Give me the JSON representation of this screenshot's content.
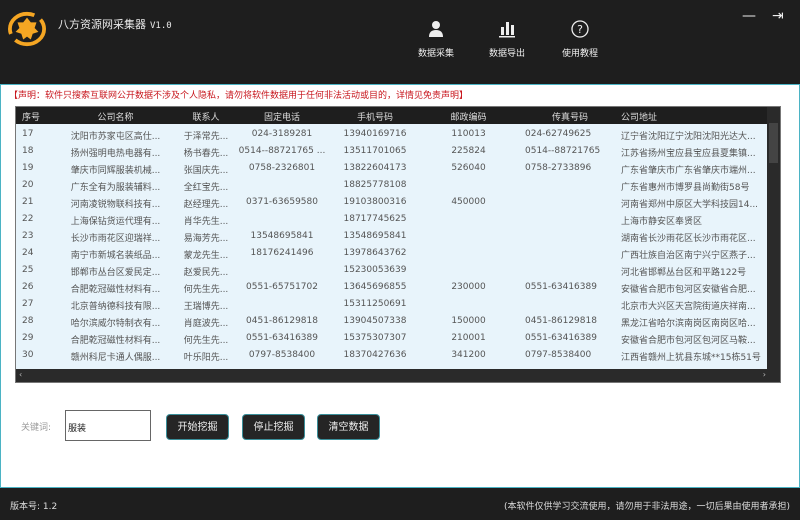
{
  "app": {
    "title": "八方资源网采集器",
    "version": "V1.0"
  },
  "nav": [
    {
      "label": "数据采集",
      "icon": "user-icon"
    },
    {
      "label": "数据导出",
      "icon": "bar-chart-icon"
    },
    {
      "label": "使用教程",
      "icon": "help-icon"
    }
  ],
  "window": {
    "minimize": "—",
    "exit": "⇥"
  },
  "notice": "【声明：软件只搜索互联网公开数据不涉及个人隐私，请勿将软件数据用于任何非法活动或目的，详情见免责声明】",
  "table": {
    "columns": [
      "序号",
      "公司名称",
      "联系人",
      "固定电话",
      "手机号码",
      "邮政编码",
      "传真号码",
      "公司地址"
    ],
    "rows": [
      [
        "17",
        "沈阳市苏家屯区高仕...",
        "于泽常先...",
        "024-3189281",
        "13940169716",
        "110013",
        "024-62749625",
        "辽宁省沈阳辽宁沈阳沈阳光达大..."
      ],
      [
        "18",
        "扬州强明电热电器有...",
        "杨书春先...",
        "0514--88721765 ...",
        "13511701065",
        "225824",
        "0514--88721765",
        "江苏省扬州宝应县宝应县夏集镇..."
      ],
      [
        "19",
        "肇庆市同辉服装机械...",
        "张国庆先...",
        "0758-2326801",
        "13822604173",
        "526040",
        "0758-2733896",
        "广东省肇庆市广东省肇庆市端州..."
      ],
      [
        "20",
        "广东全有为服装辅料...",
        "全红宝先...",
        "",
        "18825778108",
        "",
        "",
        "广东省惠州市博罗县尚勤街58号"
      ],
      [
        "21",
        "河南凌锐物联科技有...",
        "赵经理先...",
        "0371-63659580",
        "19103800316",
        "450000",
        "",
        "河南省郑州中原区大学科技园14..."
      ],
      [
        "22",
        "上海保钻货运代理有...",
        "肖华先生...",
        "",
        "18717745625",
        "",
        "",
        "上海市静安区奉贤区"
      ],
      [
        "23",
        "长沙市雨花区迎瑞祥...",
        "易海芳先...",
        "13548695841",
        "13548695841",
        "",
        "",
        "湖南省长沙雨花区长沙市雨花区..."
      ],
      [
        "24",
        "南宁市新城名装纸品...",
        "蒙龙先生...",
        "18176241496",
        "13978643762",
        "",
        "",
        "广西壮族自治区南宁兴宁区燕子..."
      ],
      [
        "25",
        "邯郸市丛台区爱民定...",
        "赵爱民先...",
        "",
        "15230053639",
        "",
        "",
        "河北省邯郸丛台区和平路122号"
      ],
      [
        "26",
        "合肥乾冠磁性材料有...",
        "何先生先...",
        "0551-65751702",
        "13645696855",
        "230000",
        "0551-63416389",
        "安徽省合肥市包河区安徽省合肥..."
      ],
      [
        "27",
        "北京普纳德科技有限...",
        "王瑞博先...",
        "",
        "15311250691",
        "",
        "",
        "北京市大兴区天宫院街道庆祥南..."
      ],
      [
        "28",
        "哈尔滨威尔特制衣有...",
        "肖庭波先...",
        "0451-86129818",
        "13904507338",
        "150000",
        "0451-86129818",
        "黑龙江省哈尔滨南岗区南岗区哈..."
      ],
      [
        "29",
        "合肥乾冠磁性材料有...",
        "何先生先...",
        "0551-63416389",
        "15375307307",
        "210001",
        "0551-63416389",
        "安徽省合肥市包河区包河区马鞍..."
      ],
      [
        "30",
        "赣州科尼卡通人偶服...",
        "叶乐阳先...",
        "0797-8538400",
        "18370427636",
        "341200",
        "0797-8538400",
        "江西省赣州上犹县东城**15栋51号"
      ]
    ]
  },
  "search": {
    "label": "关键词:",
    "value": "服装"
  },
  "buttons": {
    "start": "开始挖掘",
    "stop": "停止挖掘",
    "clear": "清空数据"
  },
  "footer": {
    "version": "版本号: 1.2",
    "disclaimer": "(本软件仅供学习交流使用，请勿用于非法用途，一切后果由使用者承担)"
  },
  "colors": {
    "accent": "#f5a623",
    "notice": "#c8161d",
    "border": "#4bb3c4"
  }
}
